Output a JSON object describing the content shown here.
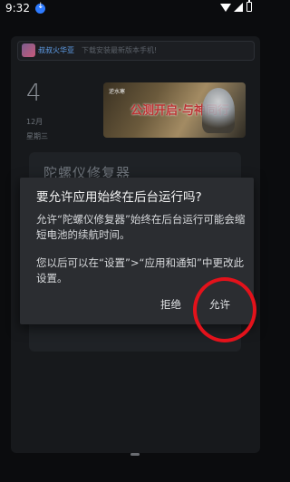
{
  "status_bar": {
    "time": "9:32"
  },
  "background_app": {
    "app_name": "叔叔火华亚",
    "search_placeholder": "下载安装最新版本手机!",
    "date_day": "4",
    "date_month": "12月",
    "date_weekday": "星期三",
    "banner_text": "公测开启·与神同行",
    "banner_logo": "逆水寒",
    "panel_title": "陀螺仪修复器"
  },
  "dialog": {
    "title": "要允许应用始终在后台运行吗?",
    "message": "允许“陀螺仪修复器”始终在后台运行可能会缩短电池的续航时间。",
    "settings_hint": "您以后可以在“设置”>“应用和通知”中更改此设置。",
    "deny_label": "拒绝",
    "allow_label": "允许"
  },
  "colors": {
    "highlight_ring": "#e3121b",
    "dialog_bg": "#2b2d31",
    "accent": "#2e7bff"
  }
}
